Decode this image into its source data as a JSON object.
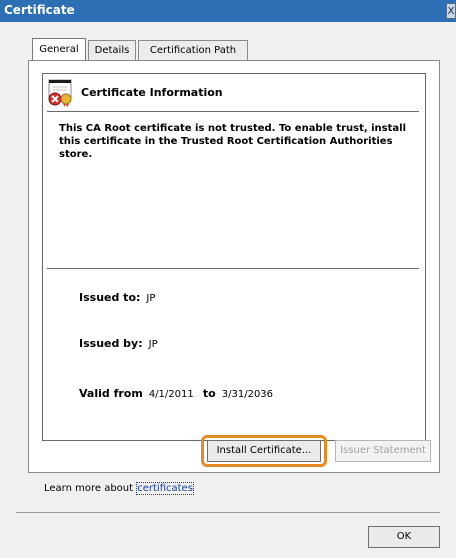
{
  "window": {
    "title": "Certificate",
    "close_glyph": "X"
  },
  "tabs": [
    {
      "label": "General",
      "active": true
    },
    {
      "label": "Details",
      "active": false
    },
    {
      "label": "Certification Path",
      "active": false
    }
  ],
  "cert": {
    "info_title": "Certificate Information",
    "trust_message": "This CA Root certificate is not trusted. To enable trust, install this certificate in the Trusted Root Certification Authorities store.",
    "issued_to_label": "Issued to:",
    "issued_to_value": "JP",
    "issued_by_label": "Issued by:",
    "issued_by_value": "JP",
    "valid_from_label": "Valid from",
    "valid_from_value": "4/1/2011",
    "to_label": "to",
    "valid_to_value": "3/31/2036"
  },
  "buttons": {
    "install": "Install Certificate...",
    "issuer_statement": "Issuer Statement",
    "ok": "OK"
  },
  "learn_more": {
    "prefix": "Learn more about ",
    "link": "certificates"
  },
  "colors": {
    "titlebar": "#2c6fb5",
    "highlight": "#e58a25"
  }
}
